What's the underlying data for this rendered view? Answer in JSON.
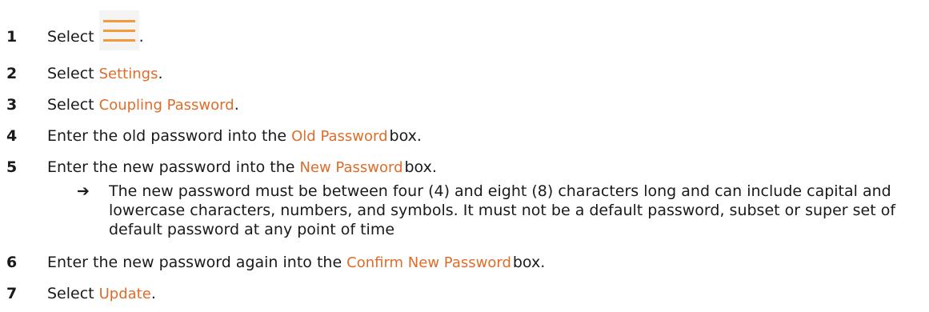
{
  "steps": [
    {
      "num": "1",
      "pre": "Select",
      "ui": "",
      "post": ".",
      "icon": "hamburger-menu-icon"
    },
    {
      "num": "2",
      "pre": "Select",
      "ui": "Settings",
      "post": "."
    },
    {
      "num": "3",
      "pre": "Select",
      "ui": "Coupling Password",
      "post": "."
    },
    {
      "num": "4",
      "pre": "Enter the old password into the",
      "ui": "Old Password",
      "post": "box."
    },
    {
      "num": "5",
      "pre": "Enter the new password into the",
      "ui": "New Password",
      "post": "box."
    },
    {
      "num": "6",
      "pre": "Enter the new password again into the",
      "ui": "Confirm New Password",
      "post": "box."
    },
    {
      "num": "7",
      "pre": "Select",
      "ui": "Update",
      "post": "."
    }
  ],
  "note": {
    "arrow": "➔",
    "text": "The new password must be between four (4) and eight (8) characters long and can include capital and lowercase characters, numbers, and symbols. It must not be a default password, subset or super set of default password at any point of time"
  },
  "colors": {
    "ui_text": "#e06c2a",
    "menu_icon_bars": "#f39a3d",
    "menu_icon_bg": "#f4f4f4"
  }
}
